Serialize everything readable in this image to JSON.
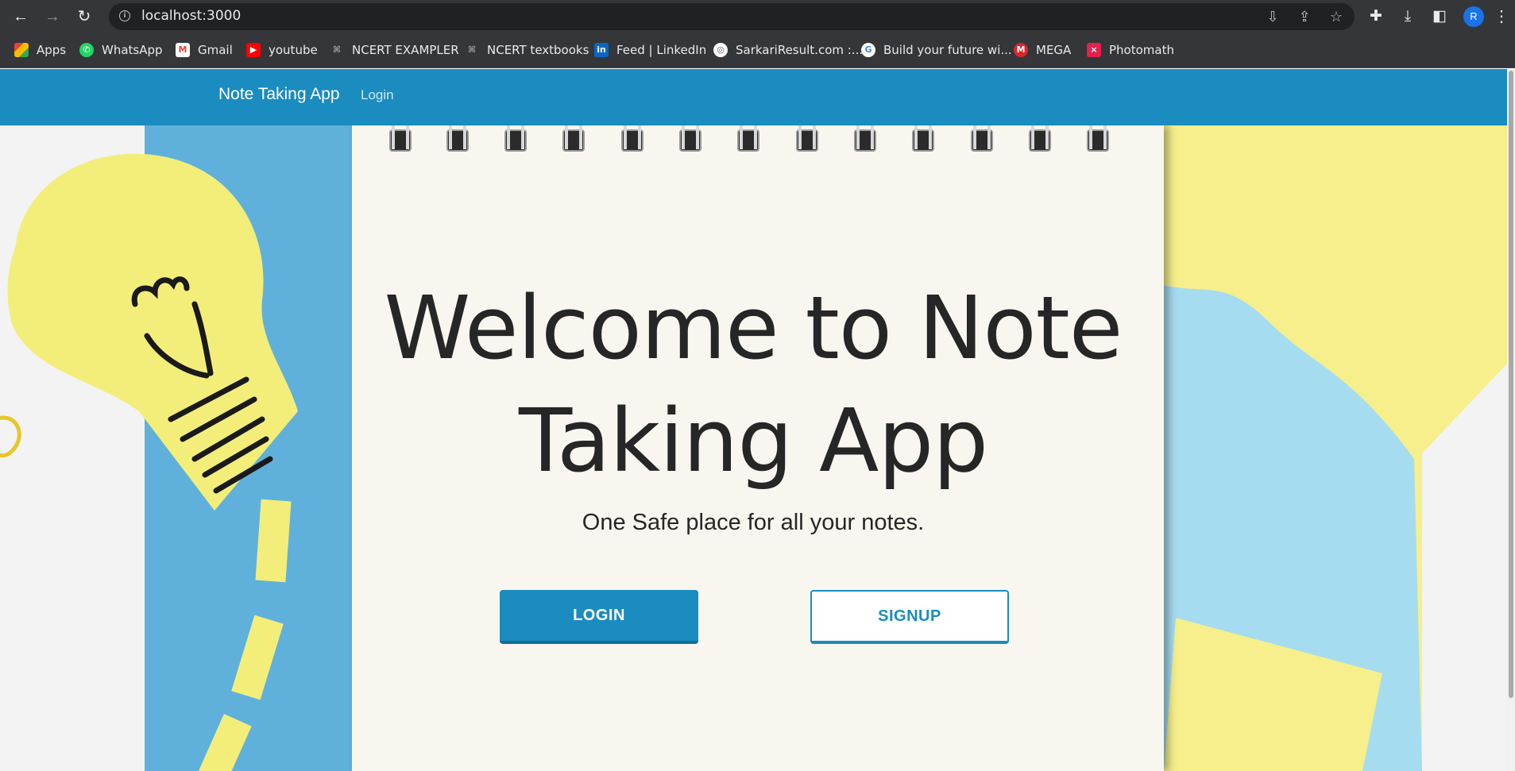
{
  "browser": {
    "url": "localhost:3000",
    "avatar_letter": "R",
    "bookmarks": [
      {
        "label": "Apps",
        "icon": "apps-grid-icon",
        "color": "#ea4335"
      },
      {
        "label": "WhatsApp",
        "icon": "whatsapp-icon",
        "color": "#25d366"
      },
      {
        "label": "Gmail",
        "icon": "gmail-icon",
        "color": "#ea4335"
      },
      {
        "label": "youtube",
        "icon": "youtube-icon",
        "color": "#ff0000"
      },
      {
        "label": "NCERT EXAMPLER",
        "icon": "ncert-icon",
        "color": "#9aa0a6"
      },
      {
        "label": "NCERT textbooks",
        "icon": "ncert-icon",
        "color": "#9aa0a6"
      },
      {
        "label": "Feed | LinkedIn",
        "icon": "linkedin-icon",
        "color": "#0a66c2"
      },
      {
        "label": "SarkariResult.com :...",
        "icon": "sarkari-icon",
        "color": "#6a4c93"
      },
      {
        "label": "Build your future wi...",
        "icon": "google-icon",
        "color": "#4285f4"
      },
      {
        "label": "MEGA",
        "icon": "mega-icon",
        "color": "#d9272e"
      },
      {
        "label": "Photomath",
        "icon": "photomath-icon",
        "color": "#e4204b"
      }
    ]
  },
  "navbar": {
    "brand": "Note Taking App",
    "login_link": "Login",
    "color": "#1a8cbf"
  },
  "hero": {
    "title_line1": "Welcome to Note",
    "title_line2": "Taking App",
    "subtitle": "One Safe place for all your notes.",
    "login_button": "LOGIN",
    "signup_button": "SIGNUP"
  }
}
